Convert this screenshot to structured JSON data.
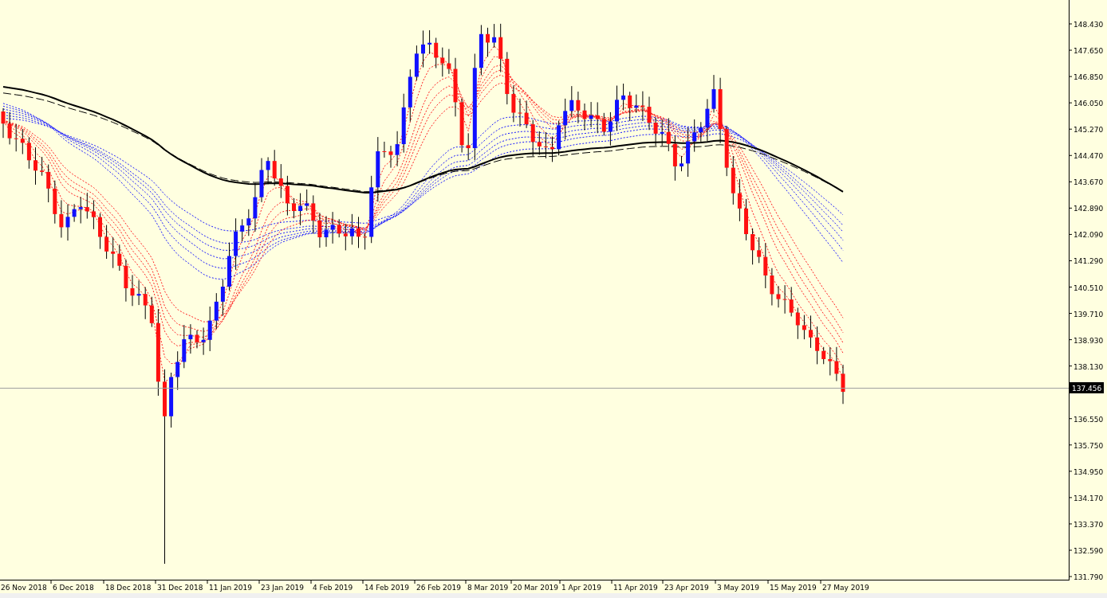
{
  "price_axis": {
    "labels_above": [
      "148.430",
      "147.650",
      "146.850",
      "146.050",
      "145.270",
      "144.470",
      "143.670",
      "142.890",
      "142.090",
      "141.290",
      "140.510",
      "139.710",
      "138.930",
      "138.130"
    ],
    "current_price": "137.456",
    "labels_below": [
      "136.550",
      "135.750",
      "134.950",
      "134.170",
      "133.370",
      "132.590",
      "131.790"
    ]
  },
  "time_axis": {
    "labels": [
      "26 Nov 2018",
      "6 Dec 2018",
      "18 Dec 2018",
      "31 Dec 2018",
      "11 Jan 2019",
      "23 Jan 2019",
      "4 Feb 2019",
      "14 Feb 2019",
      "26 Feb 2019",
      "8 Mar 2019",
      "20 Mar 2019",
      "1 Apr 2019",
      "11 Apr 2019",
      "23 Apr 2019",
      "3 May 2019",
      "15 May 2019",
      "27 May 2019"
    ]
  }
}
